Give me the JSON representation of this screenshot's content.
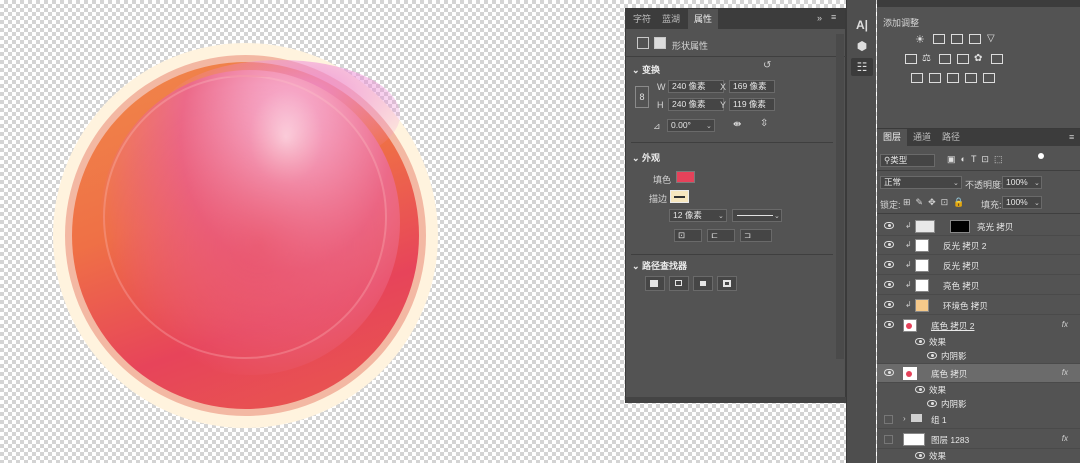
{
  "properties_panel": {
    "tabs": [
      "字符",
      "蓝湖",
      "属性"
    ],
    "panel_title": "形状属性",
    "transform": {
      "heading": "变换",
      "w_label": "W",
      "w_value": "240 像素",
      "x_label": "X",
      "x_value": "169 像素",
      "h_label": "H",
      "h_value": "240 像素",
      "y_label": "Y",
      "y_value": "119 像素",
      "angle_value": "0.00°"
    },
    "appearance": {
      "heading": "外观",
      "fill_label": "填色",
      "fill_color": "#e5425a",
      "stroke_label": "描边",
      "stroke_color": "#f7e7bf",
      "stroke_width": "12 像素"
    },
    "pathfinder": {
      "heading": "路径查找器"
    }
  },
  "adjustments": {
    "add_label": "添加调整"
  },
  "layers_panel": {
    "tabs": [
      "图层",
      "通道",
      "路径"
    ],
    "filter_kind": "类型",
    "blend_mode": "正常",
    "opacity_label": "不透明度:",
    "opacity_value": "100%",
    "lock_label": "锁定:",
    "fill_label": "填充:",
    "fill_value": "100%",
    "rows": [
      {
        "name": "亮光 拷贝"
      },
      {
        "name": "反光 拷贝 2"
      },
      {
        "name": "反光 拷贝"
      },
      {
        "name": "亮色 拷贝"
      },
      {
        "name": "环境色 拷贝"
      },
      {
        "name": "底色 拷贝 2",
        "fx": "fx",
        "effects": "效果",
        "inner_shadow": "内阴影"
      },
      {
        "name": "底色 拷贝",
        "fx": "fx",
        "effects": "效果",
        "inner_shadow": "内阴影"
      },
      {
        "name": "组 1"
      },
      {
        "name": "图层 1283",
        "fx": "fx",
        "effects": "效果"
      }
    ]
  }
}
